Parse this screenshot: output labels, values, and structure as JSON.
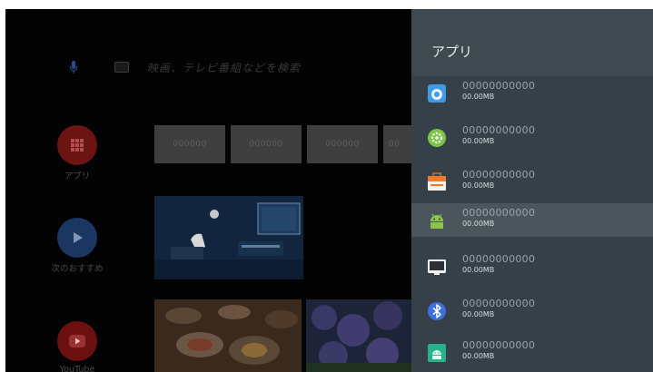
{
  "search": {
    "placeholder": "映画、テレビ番組などを検索"
  },
  "sidebar": [
    {
      "label": "アプリ"
    },
    {
      "label": "次のおすすめ"
    },
    {
      "label": "YouTube"
    }
  ],
  "tiles": [
    "000000",
    "000000",
    "000000"
  ],
  "panel": {
    "title": "アプリ",
    "apps": [
      {
        "name": "00000000000",
        "size": "00.00MB",
        "icon": "camera-app-icon",
        "color": "#4aa3f0"
      },
      {
        "name": "00000000000",
        "size": "00.00MB",
        "icon": "settings-app-icon",
        "color": "#7cc444"
      },
      {
        "name": "00000000000",
        "size": "00.00MB",
        "icon": "market-app-icon",
        "color": "#f07a2a"
      },
      {
        "name": "00000000000",
        "size": "00.00MB",
        "icon": "android-app-icon",
        "color": "#8cc34a"
      },
      {
        "name": "00000000000",
        "size": "00.00MB",
        "icon": "tv-app-icon",
        "color": "#2f3336"
      },
      {
        "name": "00000000000",
        "size": "00.00MB",
        "icon": "bluetooth-app-icon",
        "color": "#3d6fe0"
      },
      {
        "name": "00000000000",
        "size": "00.00MB",
        "icon": "android-box-app-icon",
        "color": "#26b28a"
      }
    ]
  }
}
